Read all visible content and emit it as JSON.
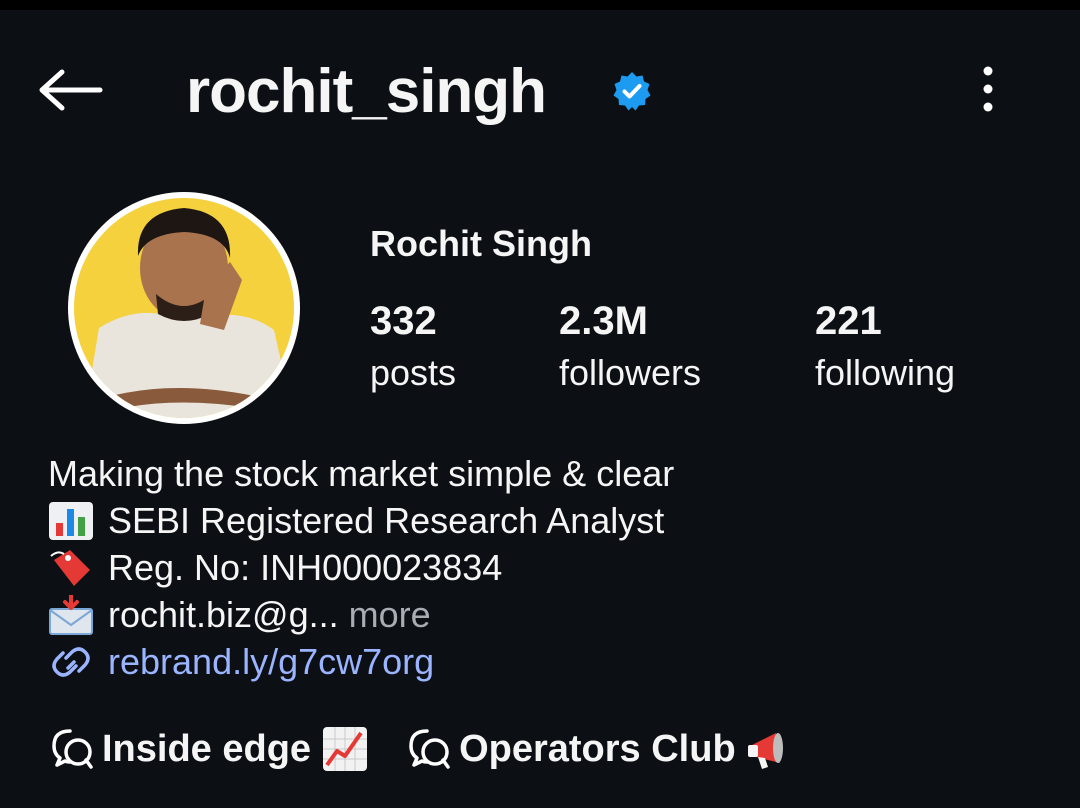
{
  "header": {
    "username": "rochit_singh",
    "verified_icon": "verified-badge-icon",
    "back_icon": "arrow-left-icon",
    "menu_icon": "more-vertical-icon"
  },
  "profile": {
    "full_name": "Rochit Singh",
    "stats": [
      {
        "value": "332",
        "label": "posts"
      },
      {
        "value": "2.3M",
        "label": "followers"
      },
      {
        "value": "221",
        "label": "following"
      }
    ]
  },
  "bio": {
    "tagline": "Making the stock market simple & clear",
    "line2": "SEBI Registered Research Analyst",
    "line3": "Reg. No: INH000023834",
    "line4": "rochit.biz@g...",
    "more": "more",
    "link": "rebrand.ly/g7cw7org"
  },
  "highlights": [
    {
      "label": "Inside edge",
      "emoji": "chart-increasing-icon"
    },
    {
      "label": "Operators Club",
      "emoji": "megaphone-icon"
    }
  ],
  "colors": {
    "background": "#0c0f14",
    "verified": "#1d9bf0",
    "link": "#9bb4ff",
    "more": "#a8acb3"
  }
}
